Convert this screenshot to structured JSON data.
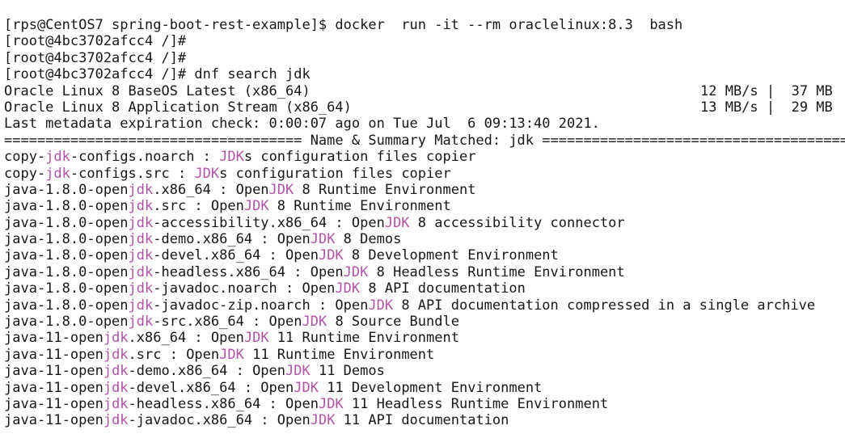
{
  "terminal": {
    "lines": [
      [
        {
          "t": "[rps@CentOS7 spring-boot-rest-example]$ docker  run -it --rm oraclelinux:8.3  bash"
        }
      ],
      [
        {
          "t": "[root@4bc3702afcc4 /]#"
        }
      ],
      [
        {
          "t": "[root@4bc3702afcc4 /]#"
        }
      ],
      [
        {
          "t": "[root@4bc3702afcc4 /]# dnf search jdk"
        }
      ],
      [
        {
          "t": "Oracle Linux 8 BaseOS Latest (x86_64)"
        },
        {
          "t": "12 MB/s |  37 MB",
          "stats": true
        }
      ],
      [
        {
          "t": "Oracle Linux 8 Application Stream (x86_64)"
        },
        {
          "t": "13 MB/s |  29 MB",
          "stats": true
        }
      ],
      [
        {
          "t": "Last metadata expiration check: 0:00:07 ago on Tue Jul  6 09:13:40 2021."
        }
      ],
      [
        {
          "t": "==================================== Name & Summary Matched: jdk ====================================="
        }
      ],
      [
        {
          "t": "copy-"
        },
        {
          "t": "jdk",
          "hl": true
        },
        {
          "t": "-configs.noarch : "
        },
        {
          "t": "JDK",
          "hl": true
        },
        {
          "t": "s configuration files copier"
        }
      ],
      [
        {
          "t": "copy-"
        },
        {
          "t": "jdk",
          "hl": true
        },
        {
          "t": "-configs.src : "
        },
        {
          "t": "JDK",
          "hl": true
        },
        {
          "t": "s configuration files copier"
        }
      ],
      [
        {
          "t": "java-1.8.0-open"
        },
        {
          "t": "jdk",
          "hl": true
        },
        {
          "t": ".x86_64 : Open"
        },
        {
          "t": "JDK",
          "hl": true
        },
        {
          "t": " 8 Runtime Environment"
        }
      ],
      [
        {
          "t": "java-1.8.0-open"
        },
        {
          "t": "jdk",
          "hl": true
        },
        {
          "t": ".src : Open"
        },
        {
          "t": "JDK",
          "hl": true
        },
        {
          "t": " 8 Runtime Environment"
        }
      ],
      [
        {
          "t": "java-1.8.0-open"
        },
        {
          "t": "jdk",
          "hl": true
        },
        {
          "t": "-accessibility.x86_64 : Open"
        },
        {
          "t": "JDK",
          "hl": true
        },
        {
          "t": " 8 accessibility connector"
        }
      ],
      [
        {
          "t": "java-1.8.0-open"
        },
        {
          "t": "jdk",
          "hl": true
        },
        {
          "t": "-demo.x86_64 : Open"
        },
        {
          "t": "JDK",
          "hl": true
        },
        {
          "t": " 8 Demos"
        }
      ],
      [
        {
          "t": "java-1.8.0-open"
        },
        {
          "t": "jdk",
          "hl": true
        },
        {
          "t": "-devel.x86_64 : Open"
        },
        {
          "t": "JDK",
          "hl": true
        },
        {
          "t": " 8 Development Environment"
        }
      ],
      [
        {
          "t": "java-1.8.0-open"
        },
        {
          "t": "jdk",
          "hl": true
        },
        {
          "t": "-headless.x86_64 : Open"
        },
        {
          "t": "JDK",
          "hl": true
        },
        {
          "t": " 8 Headless Runtime Environment"
        }
      ],
      [
        {
          "t": "java-1.8.0-open"
        },
        {
          "t": "jdk",
          "hl": true
        },
        {
          "t": "-javadoc.noarch : Open"
        },
        {
          "t": "JDK",
          "hl": true
        },
        {
          "t": " 8 API documentation"
        }
      ],
      [
        {
          "t": "java-1.8.0-open"
        },
        {
          "t": "jdk",
          "hl": true
        },
        {
          "t": "-javadoc-zip.noarch : Open"
        },
        {
          "t": "JDK",
          "hl": true
        },
        {
          "t": " 8 API documentation compressed in a single archive"
        }
      ],
      [
        {
          "t": "java-1.8.0-open"
        },
        {
          "t": "jdk",
          "hl": true
        },
        {
          "t": "-src.x86_64 : Open"
        },
        {
          "t": "JDK",
          "hl": true
        },
        {
          "t": " 8 Source Bundle"
        }
      ],
      [
        {
          "t": "java-11-open"
        },
        {
          "t": "jdk",
          "hl": true
        },
        {
          "t": ".x86_64 : Open"
        },
        {
          "t": "JDK",
          "hl": true
        },
        {
          "t": " 11 Runtime Environment"
        }
      ],
      [
        {
          "t": "java-11-open"
        },
        {
          "t": "jdk",
          "hl": true
        },
        {
          "t": ".src : Open"
        },
        {
          "t": "JDK",
          "hl": true
        },
        {
          "t": " 11 Runtime Environment"
        }
      ],
      [
        {
          "t": "java-11-open"
        },
        {
          "t": "jdk",
          "hl": true
        },
        {
          "t": "-demo.x86_64 : Open"
        },
        {
          "t": "JDK",
          "hl": true
        },
        {
          "t": " 11 Demos"
        }
      ],
      [
        {
          "t": "java-11-open"
        },
        {
          "t": "jdk",
          "hl": true
        },
        {
          "t": "-devel.x86_64 : Open"
        },
        {
          "t": "JDK",
          "hl": true
        },
        {
          "t": " 11 Development Environment"
        }
      ],
      [
        {
          "t": "java-11-open"
        },
        {
          "t": "jdk",
          "hl": true
        },
        {
          "t": "-headless.x86_64 : Open"
        },
        {
          "t": "JDK",
          "hl": true
        },
        {
          "t": " 11 Headless Runtime Environment"
        }
      ],
      [
        {
          "t": "java-11-open"
        },
        {
          "t": "jdk",
          "hl": true
        },
        {
          "t": "-javadoc.x86_64 : Open"
        },
        {
          "t": "JDK",
          "hl": true
        },
        {
          "t": " 11 API documentation"
        }
      ]
    ]
  },
  "colors": {
    "background": "#ffffff",
    "text": "#171717",
    "match_highlight": "#b154a8"
  }
}
